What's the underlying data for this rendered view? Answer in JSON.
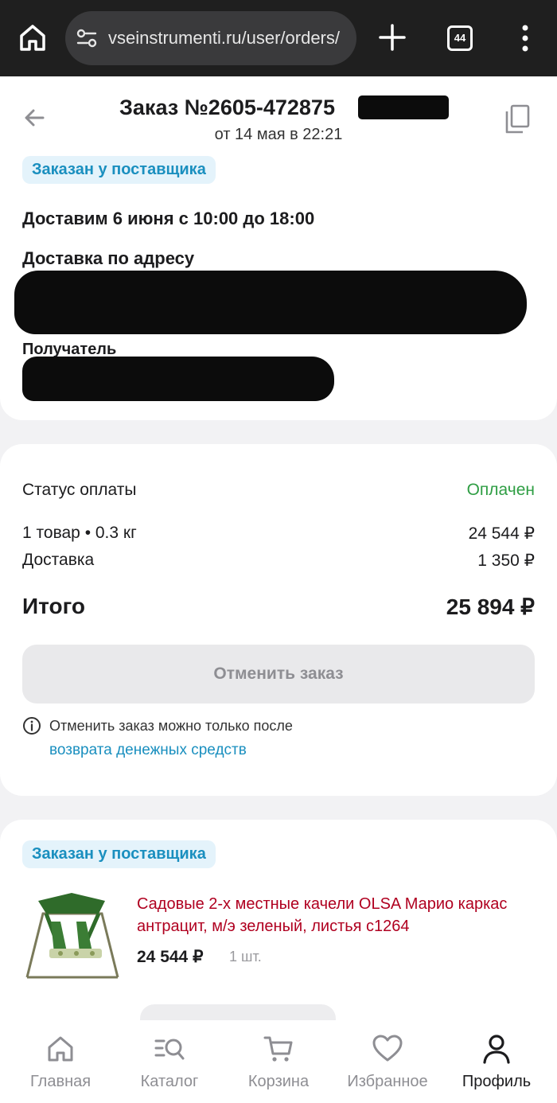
{
  "browser": {
    "url": "vseinstrumenti.ru/user/orders/",
    "tab_count": "44"
  },
  "order": {
    "title": "Заказ №2605-472875",
    "date": "от 14 мая в 22:21",
    "status": "Заказан у поставщика",
    "delivery_title": "Доставим 6 июня с 10:00 до 18:00",
    "address_label": "Доставка по адресу",
    "recipient_label": "Получатель"
  },
  "payment": {
    "status_label": "Статус оплаты",
    "status_value": "Оплачен",
    "items_label": "1 товар • 0.3 кг",
    "items_value": "24 544 ₽",
    "delivery_label": "Доставка",
    "delivery_value": "1 350 ₽",
    "total_label": "Итого",
    "total_value": "25 894 ₽",
    "cancel_button": "Отменить заказ",
    "info_text": "Отменить заказ можно только после",
    "info_link": "возврата денежных средств"
  },
  "item": {
    "status": "Заказан у поставщика",
    "name": "Садовые 2-х местные качели OLSA Марио каркас антрацит, м/э зеленый, листья с1264",
    "price": "24 544 ₽",
    "qty": "1 шт."
  },
  "nav": {
    "items": [
      {
        "label": "Главная",
        "icon": "home-icon"
      },
      {
        "label": "Каталог",
        "icon": "catalog-search-icon"
      },
      {
        "label": "Корзина",
        "icon": "cart-icon"
      },
      {
        "label": "Избранное",
        "icon": "heart-icon"
      },
      {
        "label": "Профиль",
        "icon": "profile-icon"
      }
    ],
    "active": "Профиль"
  },
  "colors": {
    "accent": "#1a8fbf",
    "paid": "#2f9e44",
    "product_link": "#b00020"
  }
}
